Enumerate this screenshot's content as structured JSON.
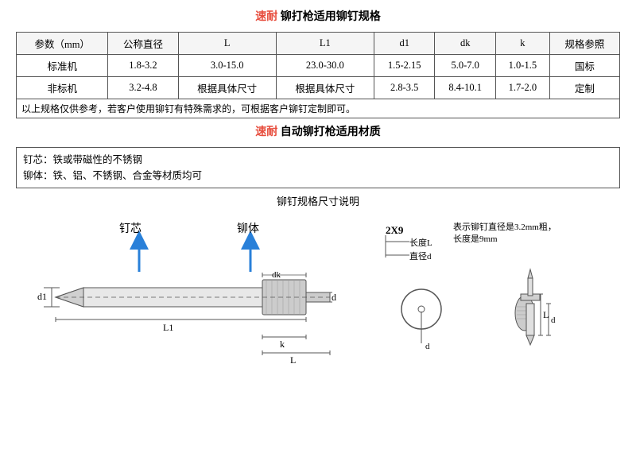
{
  "title1": {
    "brand": "速耐",
    "text": "铆打枪适用铆钉规格"
  },
  "table": {
    "headers": [
      "参数（mm）",
      "公称直径",
      "L",
      "L1",
      "d1",
      "dk",
      "k",
      "规格参照"
    ],
    "rows": [
      [
        "标准机",
        "1.8-3.2",
        "3.0-15.0",
        "23.0-30.0",
        "1.5-2.15",
        "5.0-7.0",
        "1.0-1.5",
        "国标"
      ],
      [
        "非标机",
        "3.2-4.8",
        "根据具体尺寸",
        "根据具体尺寸",
        "2.8-3.5",
        "8.4-10.1",
        "1.7-2.0",
        "定制"
      ]
    ],
    "note": "以上规格仅供参考，若客户使用铆钉有特殊需求的，可根据客户铆钉定制即可。"
  },
  "title2": {
    "brand": "速耐",
    "text": "自动铆打枪适用材质"
  },
  "material": {
    "line1": "钉芯：铁或带磁性的不锈钢",
    "line2": "铆体：铁、铝、不锈钢、合金等材质均可"
  },
  "title3": "铆钉规格尺寸说明",
  "diagram": {
    "label_dingxin": "钉芯",
    "label_liuti": "铆体",
    "label_d1": "d1",
    "label_L1": "L1",
    "label_L": "L",
    "label_k": "k",
    "label_dk": "dk",
    "label_d": "d",
    "example_label": "2X9",
    "example_desc1": "表示铆钉直径是3.2mm粗，",
    "example_desc2": "长度是9mm"
  }
}
